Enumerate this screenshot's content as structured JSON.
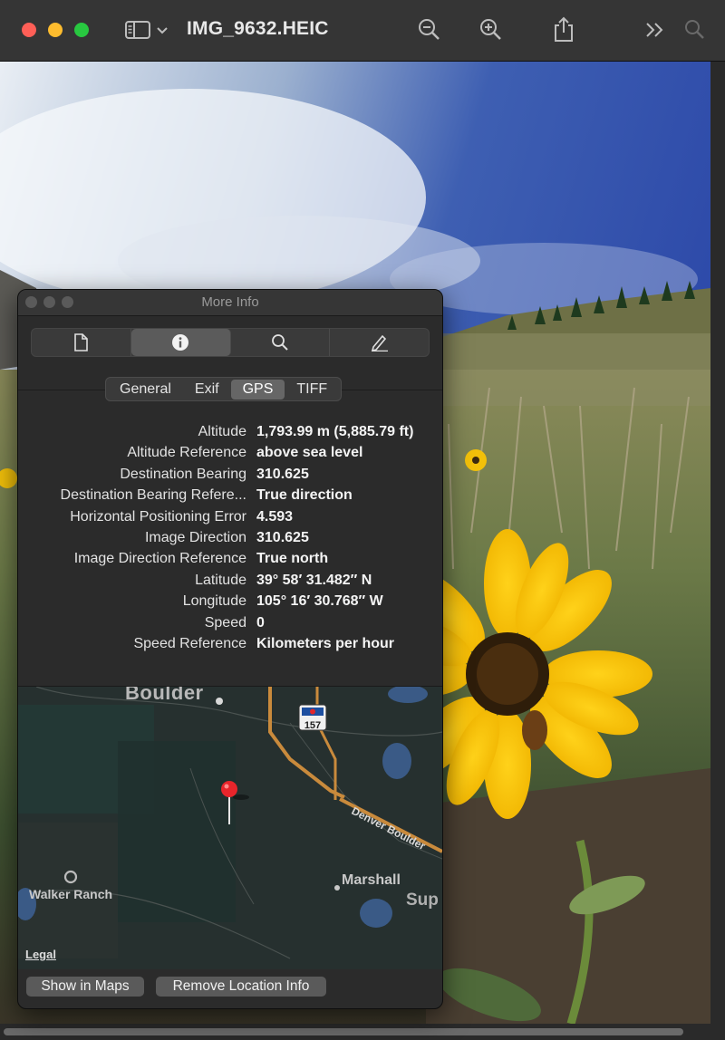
{
  "window": {
    "title": "IMG_9632.HEIC"
  },
  "panel": {
    "title": "More Info",
    "toolbar": [
      "document-icon",
      "info-icon",
      "search-icon",
      "pencil-icon"
    ],
    "tabs": [
      {
        "label": "General"
      },
      {
        "label": "Exif"
      },
      {
        "label": "GPS"
      },
      {
        "label": "TIFF"
      }
    ],
    "active_tab": "GPS",
    "rows": [
      {
        "label": "Altitude",
        "value": "1,793.99 m (5,885.79 ft)"
      },
      {
        "label": "Altitude Reference",
        "value": "above sea level"
      },
      {
        "label": "Destination Bearing",
        "value": "310.625"
      },
      {
        "label": "Destination Bearing Refere...",
        "value": "True direction"
      },
      {
        "label": "Horizontal Positioning Error",
        "value": "4.593"
      },
      {
        "label": "Image Direction",
        "value": "310.625"
      },
      {
        "label": "Image Direction Reference",
        "value": "True north"
      },
      {
        "label": "Latitude",
        "value": "39° 58′ 31.482″ N"
      },
      {
        "label": "Longitude",
        "value": "105° 16′ 30.768″ W"
      },
      {
        "label": "Speed",
        "value": "0"
      },
      {
        "label": "Speed Reference",
        "value": "Kilometers per hour"
      }
    ],
    "map": {
      "labels": {
        "boulder": "Boulder",
        "walker_ranch": "Walker Ranch",
        "marshall": "Marshall",
        "sup": "Sup",
        "road": "Denver Boulder",
        "route_shield": "157"
      },
      "legal": "Legal"
    },
    "buttons": {
      "show_in_maps": "Show in Maps",
      "remove_location": "Remove Location Info"
    }
  },
  "colors": {
    "close": "#ff5f57",
    "minimize": "#febc2e",
    "zoom": "#28c840",
    "map_pin": "#e8252b",
    "road": "#c98a3c"
  }
}
